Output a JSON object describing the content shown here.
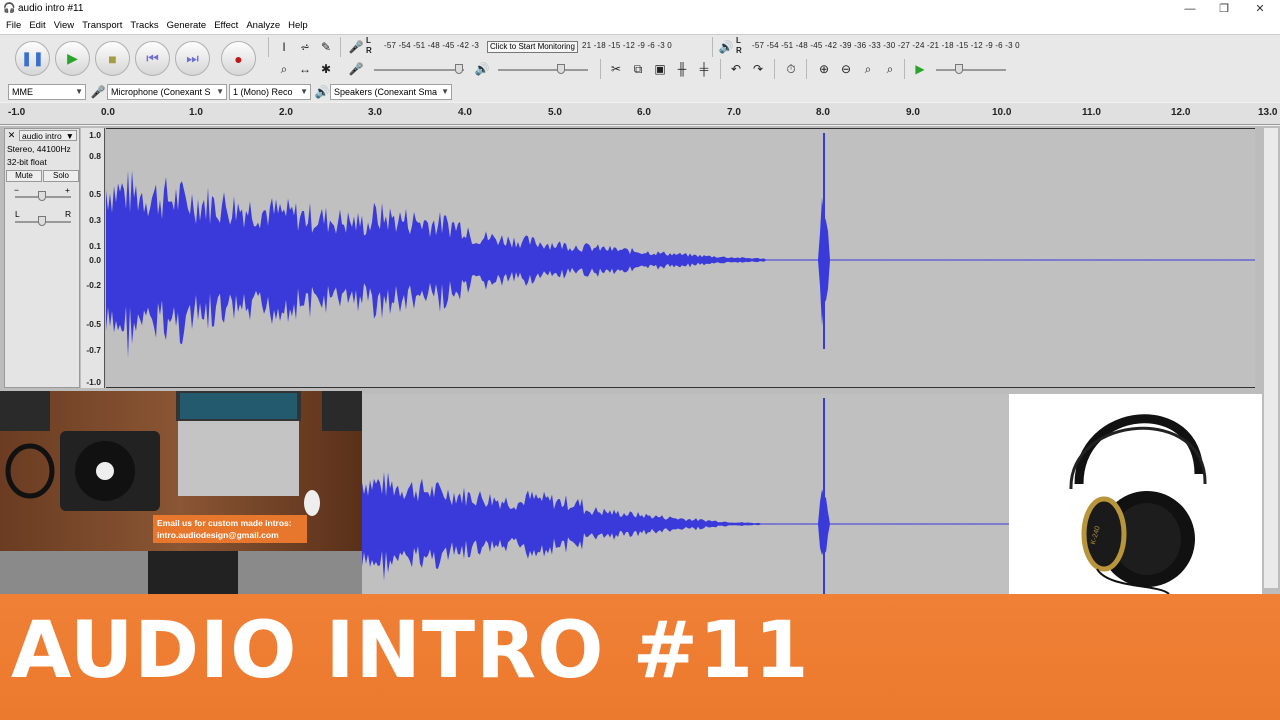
{
  "window": {
    "title": "audio intro #11",
    "minimize": "—",
    "maximize": "❐",
    "close": "✕"
  },
  "menu": [
    "File",
    "Edit",
    "View",
    "Transport",
    "Tracks",
    "Generate",
    "Effect",
    "Analyze",
    "Help"
  ],
  "meters": {
    "record_label_l": "L",
    "record_label_r": "R",
    "record_scale": "-57 -54 -51 -48 -45 -42 -3",
    "record_scale_right": "21 -18 -15 -12 -9 -6 -3 0",
    "tooltip": "Click to Start Monitoring",
    "playback_label_l": "L",
    "playback_label_r": "R",
    "playback_scale": "-57 -54 -51 -48 -45 -42 -39 -36 -33 -30 -27 -24 -21 -18 -15 -12 -9 -6 -3 0"
  },
  "devices": {
    "host": "MME",
    "input": "Microphone (Conexant S",
    "channels": "1 (Mono) Reco",
    "output": "Speakers (Conexant Sma"
  },
  "ruler": [
    "-1.0",
    "0.0",
    "1.0",
    "2.0",
    "3.0",
    "4.0",
    "5.0",
    "6.0",
    "7.0",
    "8.0",
    "9.0",
    "10.0",
    "11.0",
    "12.0",
    "13.0"
  ],
  "track": {
    "name": "audio intro",
    "format": "Stereo, 44100Hz",
    "bitdepth": "32-bit float",
    "mute": "Mute",
    "solo": "Solo",
    "gain_minus": "−",
    "gain_plus": "+",
    "pan_l": "L",
    "pan_r": "R",
    "scale": [
      "1.0",
      "0.8",
      "0.5",
      "0.3",
      "0.1",
      "0.0",
      "-0.2",
      "-0.5",
      "-0.7",
      "-1.0"
    ]
  },
  "overlay": {
    "email_line1": "Email us for custom made intros:",
    "email_line2": "intro.audiodesign@gmail.com",
    "headphone_brand": "K-240"
  },
  "banner": {
    "text": "AUDIO INTRO #11"
  },
  "colors": {
    "waveform": "#3a3adb",
    "banner": "#ee7d32",
    "track_bg": "#c0c0c0"
  }
}
